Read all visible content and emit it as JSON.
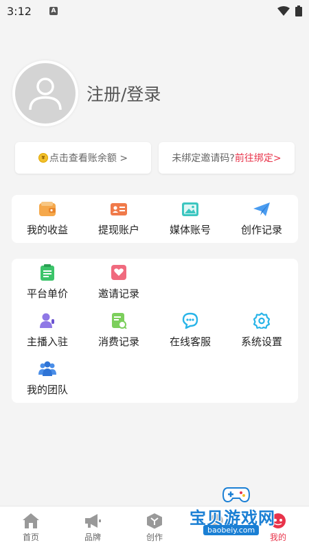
{
  "status_bar": {
    "time": "3:12",
    "notification_badge": "A"
  },
  "profile": {
    "login_text": "注册/登录"
  },
  "promo": {
    "balance_text": "点击查看账余额 >",
    "invite_prompt": "未绑定邀请码?",
    "invite_link": "前往绑定>"
  },
  "quick_menu": [
    {
      "label": "我的收益",
      "icon": "wallet-icon"
    },
    {
      "label": "提现账户",
      "icon": "id-card-icon"
    },
    {
      "label": "媒体账号",
      "icon": "image-icon"
    },
    {
      "label": "创作记录",
      "icon": "send-icon"
    }
  ],
  "service_menu": [
    {
      "label": "平台单价",
      "icon": "clipboard-icon"
    },
    {
      "label": "邀请记录",
      "icon": "heart-envelope-icon"
    },
    {
      "label": "主播入驻",
      "icon": "streamer-icon"
    },
    {
      "label": "消费记录",
      "icon": "receipt-icon"
    },
    {
      "label": "在线客服",
      "icon": "chat-icon"
    },
    {
      "label": "系统设置",
      "icon": "gear-icon"
    },
    {
      "label": "我的团队",
      "icon": "team-icon"
    }
  ],
  "bottom_nav": [
    {
      "label": "首页",
      "icon": "home-icon"
    },
    {
      "label": "品牌",
      "icon": "megaphone-icon"
    },
    {
      "label": "创作",
      "icon": "cube-icon"
    },
    {
      "label": "",
      "icon": "placeholder-icon"
    },
    {
      "label": "我的",
      "icon": "user-icon"
    }
  ],
  "watermark": {
    "text": "宝贝游戏网",
    "url": "baobeiy.com"
  },
  "colors": {
    "accent": "#e8334a",
    "background": "#f4f4f4"
  }
}
